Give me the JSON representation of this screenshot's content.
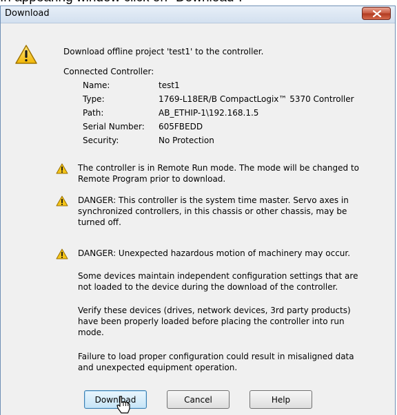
{
  "instruction": "In appearing window click on \"Download\".",
  "window": {
    "title": "Download"
  },
  "header": {
    "message": "Download offline project 'test1' to the controller."
  },
  "controller": {
    "heading": "Connected Controller:",
    "rows": [
      {
        "label": "Name:",
        "value": "test1"
      },
      {
        "label": "Type:",
        "value": "1769-L18ER/B CompactLogix™ 5370 Controller"
      },
      {
        "label": "Path:",
        "value": "AB_ETHIP-1\\192.168.1.5"
      },
      {
        "label": "Serial Number:",
        "value": "605FBEDD"
      },
      {
        "label": "Security:",
        "value": "No Protection"
      }
    ]
  },
  "warnings": {
    "remote_run": [
      "The controller is in Remote Run mode. The mode will be changed to",
      "Remote Program prior to download."
    ],
    "time_master": [
      "DANGER: This controller is the system time master.  Servo axes in",
      "synchronized controllers, in this chassis or other chassis, may be",
      "turned off."
    ],
    "hazard": "DANGER: Unexpected hazardous motion of machinery may occur."
  },
  "paragraphs": {
    "p1": [
      "Some devices maintain independent configuration settings that are",
      "not loaded to the device during the download of the controller."
    ],
    "p2": [
      "Verify these devices (drives, network devices, 3rd party products)",
      "have been properly loaded before placing the controller into run",
      "mode."
    ],
    "p3": [
      "Failure to load proper configuration could result in misaligned data",
      "and unexpected equipment operation."
    ]
  },
  "buttons": {
    "download": "Download",
    "cancel": "Cancel",
    "help": "Help"
  },
  "icons": {
    "warning": "warning-icon",
    "close": "close-icon",
    "cursor": "mouse-cursor-icon"
  },
  "colors": {
    "close_red": "#c8583e",
    "dialog_bg": "#f0f0f0",
    "warning_yellow": "#f5c518"
  }
}
